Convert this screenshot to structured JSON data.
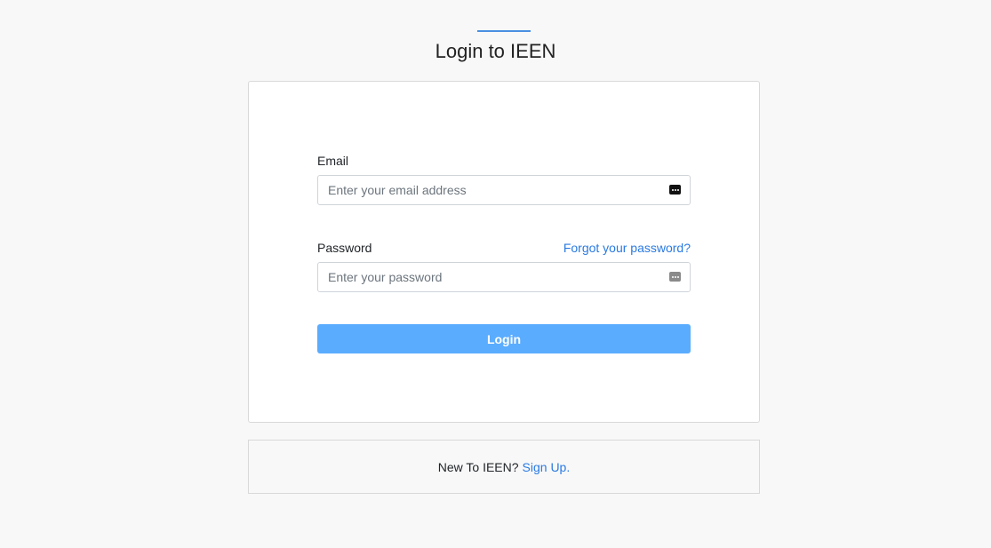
{
  "page": {
    "title": "Login to IEEN",
    "accent_color": "#4a90e2"
  },
  "form": {
    "email_label": "Email",
    "email_placeholder": "Enter your email address",
    "email_value": "",
    "password_label": "Password",
    "password_placeholder": "Enter your password",
    "password_value": "",
    "forgot_label": "Forgot your password?",
    "submit_label": "Login",
    "submit_color": "#5aacff",
    "link_color": "#2a7ae2",
    "email_icon": "password-manager-key-icon",
    "password_icon": "password-manager-key-icon"
  },
  "signup": {
    "prompt": "New To IEEN?",
    "link_label": "Sign Up."
  }
}
